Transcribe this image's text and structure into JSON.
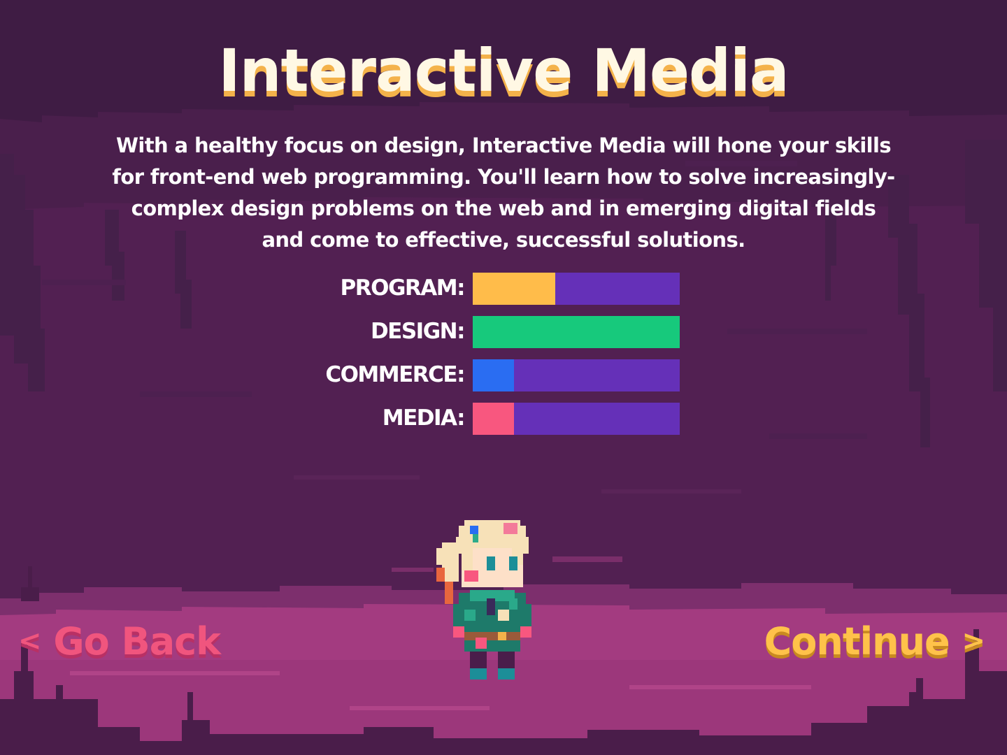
{
  "title": "Interactive Media",
  "description": "With a healthy focus on design, Interactive Media will hone your skills for front-end web programming. You'll learn how to solve increasingly-complex design problems on the web and in emerging digital fields and come to effective, successful solutions.",
  "stats": [
    {
      "label": "PROGRAM:",
      "value": 0.4,
      "color": "#ffbc4a"
    },
    {
      "label": "DESIGN:",
      "value": 1.0,
      "color": "#17c97c"
    },
    {
      "label": "COMMERCE:",
      "value": 0.2,
      "color": "#2a6df2"
    },
    {
      "label": "MEDIA:",
      "value": 0.2,
      "color": "#f8577f"
    }
  ],
  "nav": {
    "back_arrow": "<",
    "back_label": "Go Back",
    "continue_label": "Continue",
    "continue_arrow": ">"
  },
  "colors": {
    "background": "#3f1c44",
    "cave_mid": "#52204f",
    "ground": "#a33b80",
    "title_shadow": "#f4b24a",
    "bar_track": "#6530b8"
  },
  "character": {
    "icon": "pixel-hero-sprite"
  }
}
